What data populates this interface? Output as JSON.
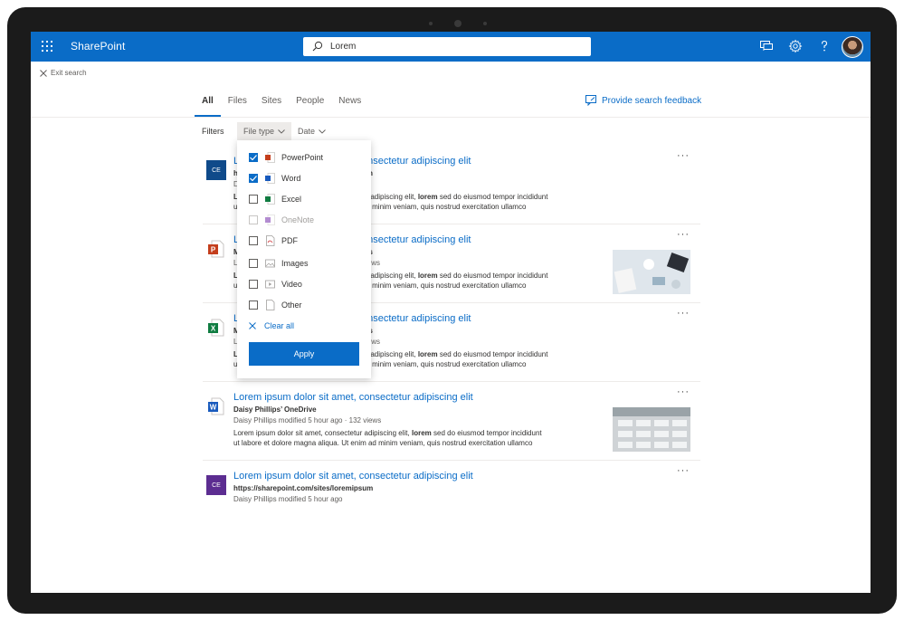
{
  "app": {
    "brand": "SharePoint"
  },
  "search": {
    "value": "Lorem"
  },
  "exit_search": "Exit search",
  "tabs": [
    {
      "label": "All",
      "active": true
    },
    {
      "label": "Files"
    },
    {
      "label": "Sites"
    },
    {
      "label": "People"
    },
    {
      "label": "News"
    }
  ],
  "feedback_label": "Provide search feedback",
  "filters": {
    "label": "Filters",
    "file_type": "File type",
    "date": "Date"
  },
  "file_type_menu": {
    "options": [
      {
        "label": "PowerPoint",
        "checked": true,
        "icon": "powerpoint-icon"
      },
      {
        "label": "Word",
        "checked": true,
        "icon": "word-icon"
      },
      {
        "label": "Excel",
        "checked": false,
        "icon": "excel-icon"
      },
      {
        "label": "OneNote",
        "checked": false,
        "disabled": true,
        "icon": "onenote-icon"
      },
      {
        "label": "PDF",
        "checked": false,
        "icon": "pdf-icon"
      },
      {
        "label": "Images",
        "checked": false,
        "icon": "image-icon"
      },
      {
        "label": "Video",
        "checked": false,
        "icon": "video-icon"
      },
      {
        "label": "Other",
        "checked": false,
        "icon": "document-icon"
      }
    ],
    "clear_all": "Clear all",
    "apply": "Apply"
  },
  "results": [
    {
      "icon": "site-icon",
      "icon_text": "CE",
      "icon_color": "#0f4a8a",
      "title_visible": "onsectetur adipiscing elit",
      "site_visible": "um",
      "snippet_line1": {
        "pre": "ur adipiscing elit, ",
        "bold": "lorem",
        "post": " sed do eiusmod tempor incididunt"
      },
      "snippet_line2": "ad minim veniam, quis nostrud exercitation ullamco"
    },
    {
      "icon": "powerpoint-icon",
      "title_visible": "onsectetur adipiscing elit",
      "site_visible": "nts",
      "meta_visible": "views",
      "snippet_line1": {
        "pre": "ur adipiscing elit, ",
        "bold": "lorem",
        "post": " sed do eiusmod tempor incididunt"
      },
      "snippet_line2": "ad minim veniam, quis nostrud exercitation ullamco"
    },
    {
      "icon": "excel-icon",
      "title_visible": "onsectetur adipiscing elit",
      "site_visible": "nts",
      "meta_visible": "views",
      "snippet_line1": {
        "pre": "ur adipiscing elit, ",
        "bold": "lorem",
        "post": " sed do eiusmod tempor incididunt"
      },
      "snippet_line2": "ad minim veniam, quis nostrud exercitation ullamco"
    },
    {
      "icon": "word-icon",
      "title": "Lorem ipsum dolor sit amet, consectetur adipiscing elit",
      "site": "Daisy Phillips’ OneDrive",
      "meta": "Daisy Phillips modified 5 hour ago  ·  132 views",
      "snippet_line1": {
        "pre": "Lorem ipsum dolor sit amet, consectetur adipiscing elit, ",
        "bold": "lorem",
        "post": " sed do eiusmod tempor incididunt"
      },
      "snippet_line2": "ut labore et dolore magna aliqua. Ut enim ad minim veniam, quis nostrud exercitation ullamco"
    },
    {
      "icon": "site-icon",
      "icon_text": "CE",
      "icon_color": "#5c2d91",
      "title": "Lorem ipsum dolor sit amet, consectetur adipiscing elit",
      "site": "https://sharepoint.com/sites/loremipsum",
      "meta": "Daisy Phillips modified 5 hour ago"
    }
  ],
  "partial_letters": {
    "r1": [
      "Lor",
      "h",
      "D",
      "L",
      "u"
    ],
    "r2": [
      "Lor",
      "M",
      "L",
      "L",
      "u"
    ],
    "r3": [
      "Lor",
      "M",
      "L",
      "L",
      "u"
    ]
  },
  "more_label": "···",
  "colors": {
    "accent": "#0a6cc7",
    "suitebar": "#0a6cc7"
  }
}
